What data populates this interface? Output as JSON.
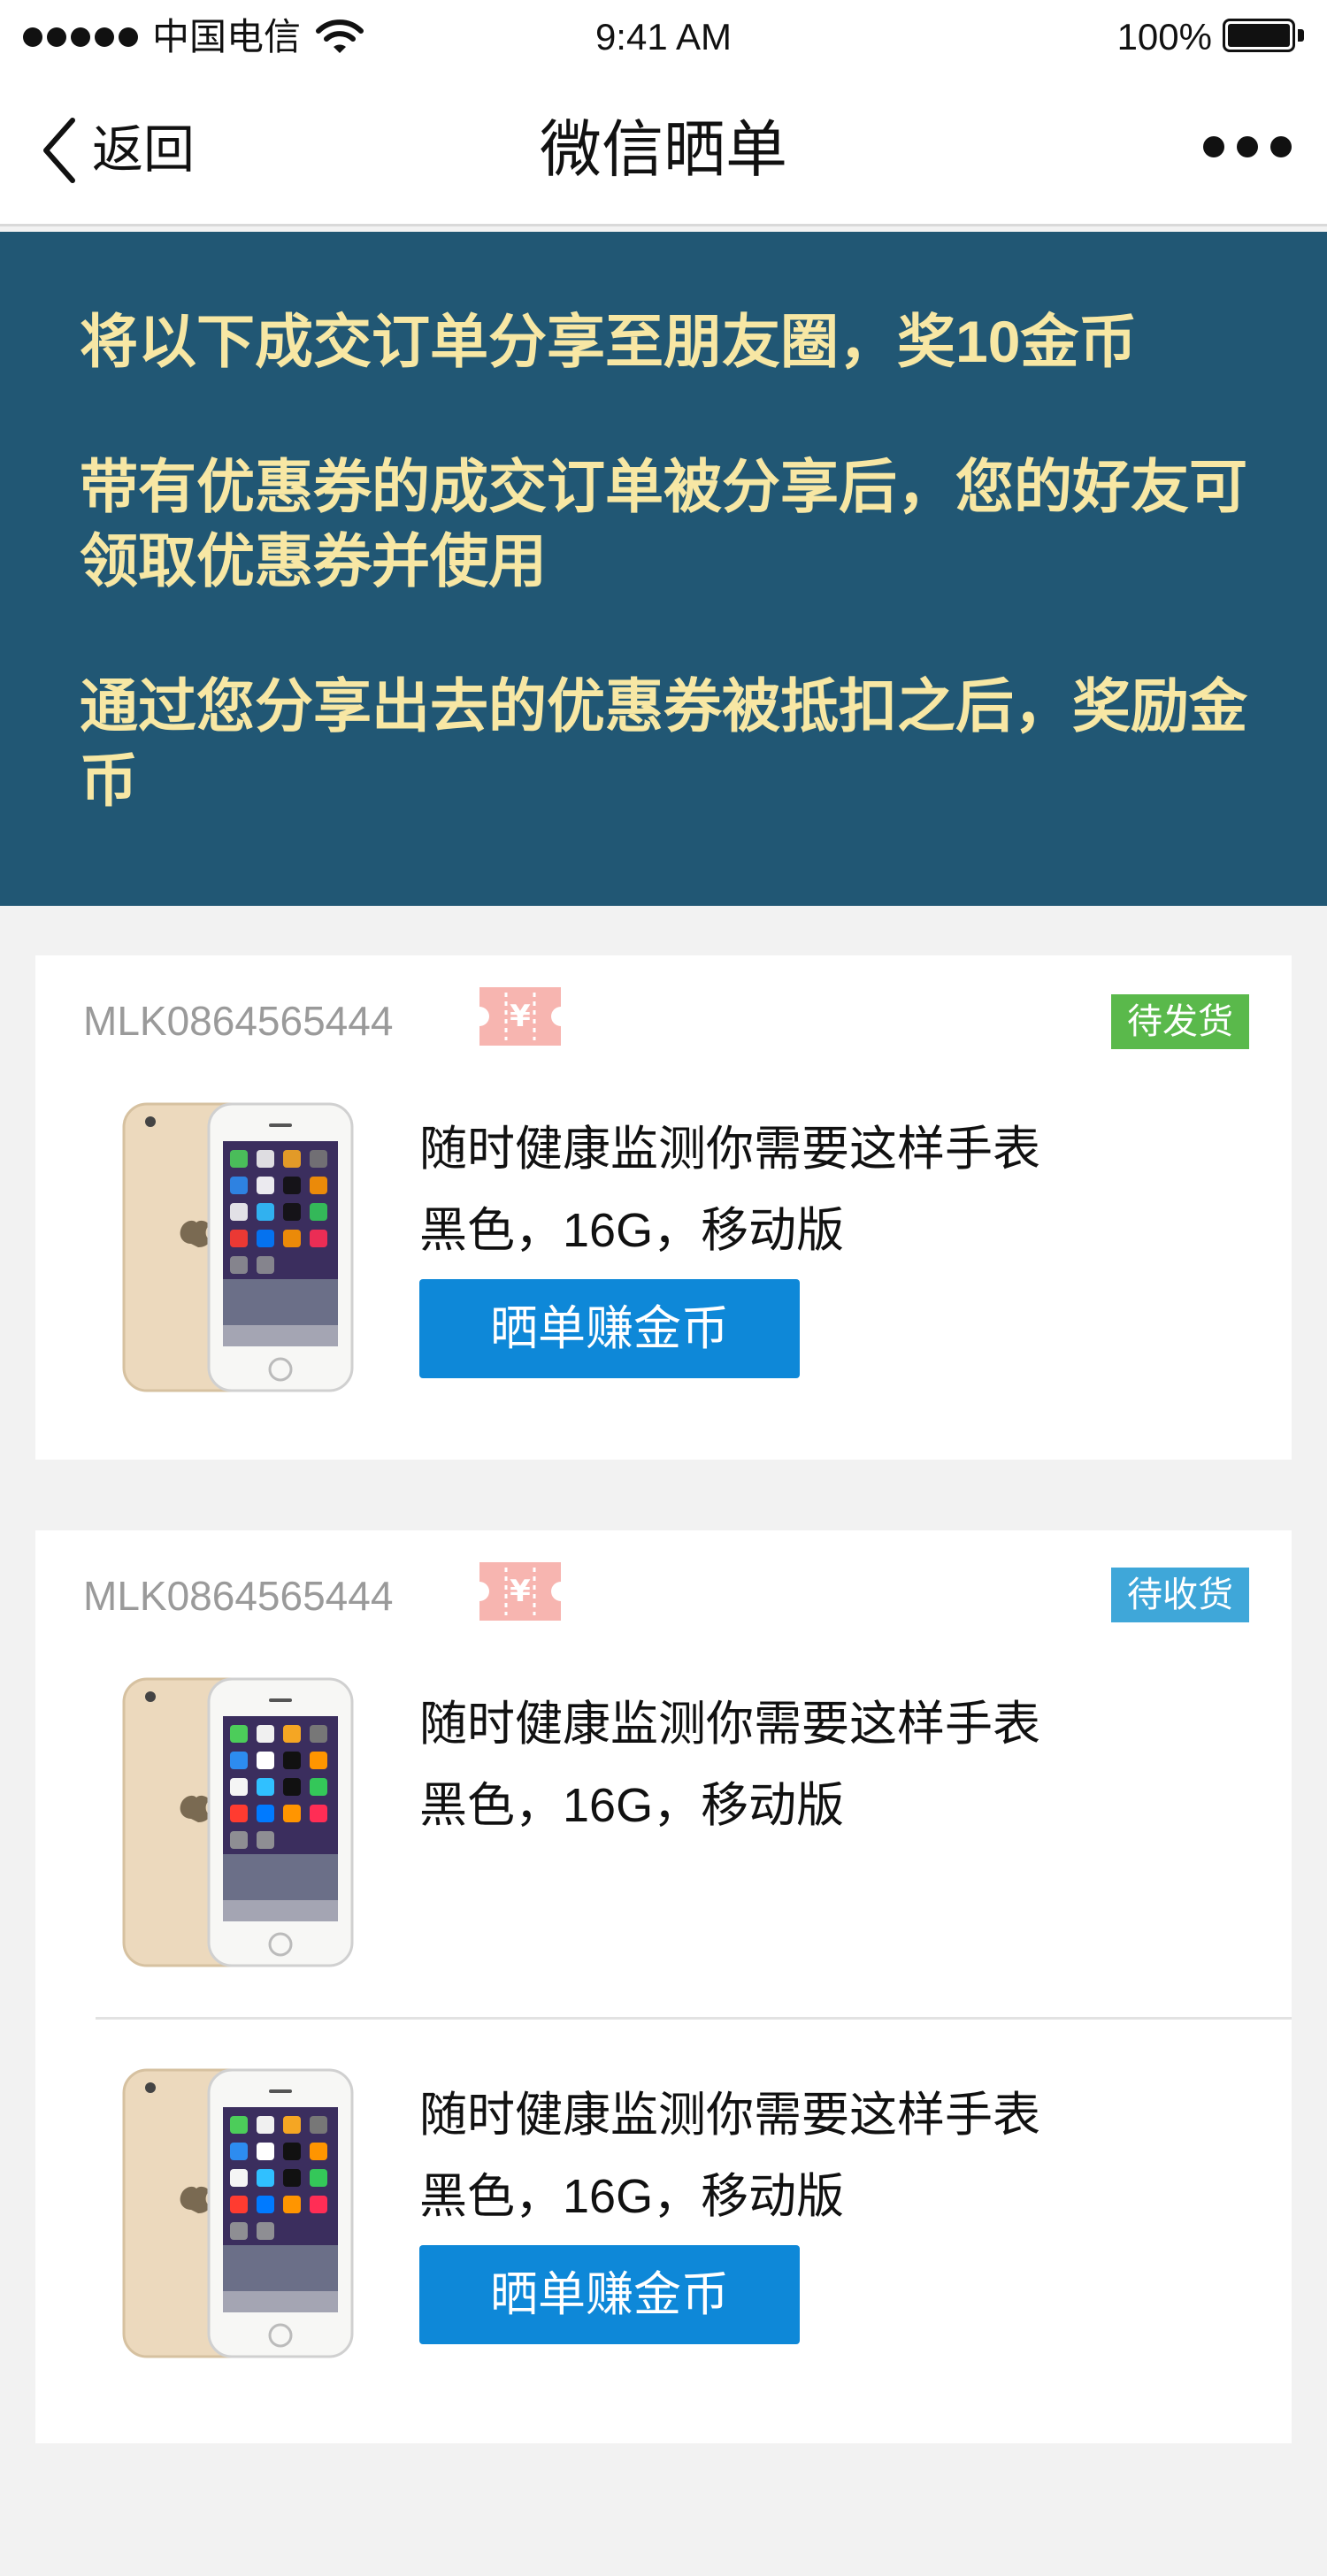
{
  "status_bar": {
    "carrier": "中国电信",
    "time": "9:41 AM",
    "battery": "100%"
  },
  "nav": {
    "back_label": "返回",
    "title": "微信晒单"
  },
  "banner": {
    "line1": "将以下成交订单分享至朋友圈，奖10金币",
    "line2": "带有优惠券的成交订单被分享后，您的好友可领取优惠券并使用",
    "line3": "通过您分享出去的优惠券被抵扣之后，奖励金币",
    "text_color": "#f7e7a4",
    "background": "#215774"
  },
  "orders": [
    {
      "order_no": "MLK0864565444",
      "coupon_symbol": "¥",
      "status": "待发货",
      "status_color": "#5ab94b",
      "products": [
        {
          "name": "随时健康监测你需要这样手表",
          "spec": "黑色，16G，移动版",
          "button": "晒单赚金币"
        }
      ]
    },
    {
      "order_no": "MLK0864565444",
      "coupon_symbol": "¥",
      "status": "待收货",
      "status_color": "#3fa7d9",
      "products": [
        {
          "name": "随时健康监测你需要这样手表",
          "spec": "黑色，16G，移动版"
        },
        {
          "name": "随时健康监测你需要这样手表",
          "spec": "黑色，16G，移动版",
          "button": "晒单赚金币"
        }
      ]
    }
  ],
  "button_color": "#0e88d8"
}
